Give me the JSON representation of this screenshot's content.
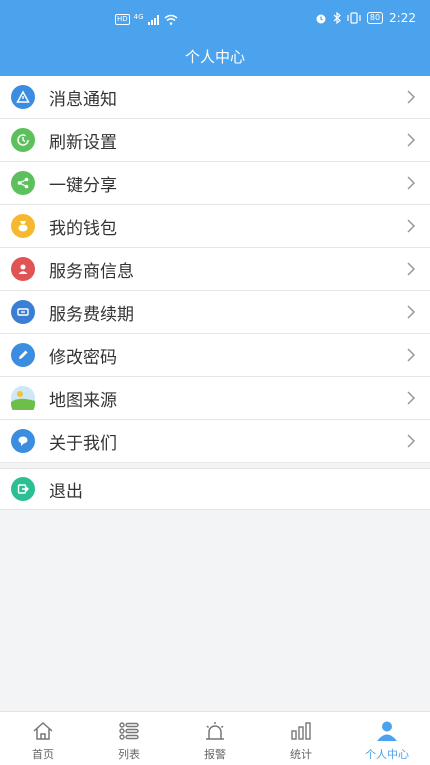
{
  "status_bar": {
    "network_badge": "HD",
    "network_type": "4G",
    "battery": "80",
    "time": "2:22"
  },
  "page": {
    "title": "个人中心"
  },
  "menu_items": [
    {
      "label": "消息通知",
      "icon": "warning-icon",
      "color": "#3b8de0"
    },
    {
      "label": "刷新设置",
      "icon": "clock-refresh-icon",
      "color": "#5cc05c"
    },
    {
      "label": "一键分享",
      "icon": "share-icon",
      "color": "#5cc05c"
    },
    {
      "label": "我的钱包",
      "icon": "wallet-icon",
      "color": "#f5b82e"
    },
    {
      "label": "服务商信息",
      "icon": "person-icon",
      "color": "#e05454"
    },
    {
      "label": "服务费续期",
      "icon": "ticket-icon",
      "color": "#3b7fd4"
    },
    {
      "label": "修改密码",
      "icon": "pencil-icon",
      "color": "#3b8de0"
    },
    {
      "label": "地图来源",
      "icon": "map-icon",
      "color": "#8ccf5a"
    },
    {
      "label": "关于我们",
      "icon": "chat-bubble-icon",
      "color": "#3b8de0"
    }
  ],
  "logout": {
    "label": "退出",
    "icon": "logout-icon",
    "color": "#2dbf94"
  },
  "tabbar": [
    {
      "label": "首页",
      "icon": "home-icon"
    },
    {
      "label": "列表",
      "icon": "list-icon"
    },
    {
      "label": "报警",
      "icon": "alarm-icon"
    },
    {
      "label": "统计",
      "icon": "stats-icon"
    },
    {
      "label": "个人中心",
      "icon": "user-icon"
    }
  ],
  "colors": {
    "accent": "#4aa3ec"
  }
}
